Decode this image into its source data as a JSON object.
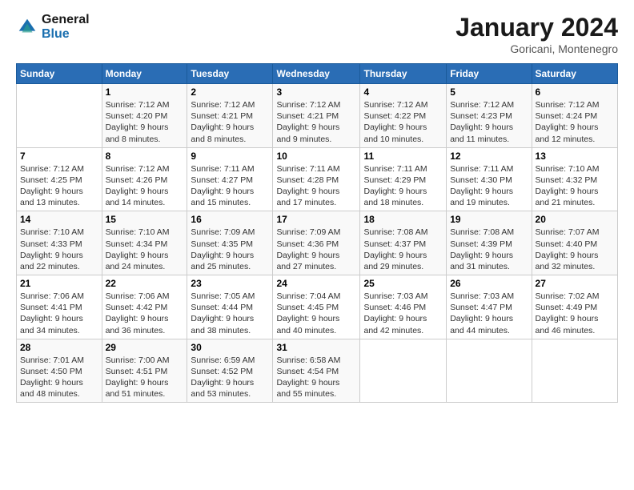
{
  "header": {
    "logo_general": "General",
    "logo_blue": "Blue",
    "main_title": "January 2024",
    "subtitle": "Goricani, Montenegro"
  },
  "calendar": {
    "days_of_week": [
      "Sunday",
      "Monday",
      "Tuesday",
      "Wednesday",
      "Thursday",
      "Friday",
      "Saturday"
    ],
    "weeks": [
      [
        {
          "day": "",
          "info": ""
        },
        {
          "day": "1",
          "info": "Sunrise: 7:12 AM\nSunset: 4:20 PM\nDaylight: 9 hours\nand 8 minutes."
        },
        {
          "day": "2",
          "info": "Sunrise: 7:12 AM\nSunset: 4:21 PM\nDaylight: 9 hours\nand 8 minutes."
        },
        {
          "day": "3",
          "info": "Sunrise: 7:12 AM\nSunset: 4:21 PM\nDaylight: 9 hours\nand 9 minutes."
        },
        {
          "day": "4",
          "info": "Sunrise: 7:12 AM\nSunset: 4:22 PM\nDaylight: 9 hours\nand 10 minutes."
        },
        {
          "day": "5",
          "info": "Sunrise: 7:12 AM\nSunset: 4:23 PM\nDaylight: 9 hours\nand 11 minutes."
        },
        {
          "day": "6",
          "info": "Sunrise: 7:12 AM\nSunset: 4:24 PM\nDaylight: 9 hours\nand 12 minutes."
        }
      ],
      [
        {
          "day": "7",
          "info": ""
        },
        {
          "day": "8",
          "info": "Sunrise: 7:12 AM\nSunset: 4:26 PM\nDaylight: 9 hours\nand 14 minutes."
        },
        {
          "day": "9",
          "info": "Sunrise: 7:11 AM\nSunset: 4:27 PM\nDaylight: 9 hours\nand 15 minutes."
        },
        {
          "day": "10",
          "info": "Sunrise: 7:11 AM\nSunset: 4:28 PM\nDaylight: 9 hours\nand 17 minutes."
        },
        {
          "day": "11",
          "info": "Sunrise: 7:11 AM\nSunset: 4:29 PM\nDaylight: 9 hours\nand 18 minutes."
        },
        {
          "day": "12",
          "info": "Sunrise: 7:11 AM\nSunset: 4:30 PM\nDaylight: 9 hours\nand 19 minutes."
        },
        {
          "day": "13",
          "info": "Sunrise: 7:10 AM\nSunset: 4:32 PM\nDaylight: 9 hours\nand 21 minutes."
        }
      ],
      [
        {
          "day": "14",
          "info": ""
        },
        {
          "day": "15",
          "info": "Sunrise: 7:10 AM\nSunset: 4:34 PM\nDaylight: 9 hours\nand 24 minutes."
        },
        {
          "day": "16",
          "info": "Sunrise: 7:09 AM\nSunset: 4:35 PM\nDaylight: 9 hours\nand 25 minutes."
        },
        {
          "day": "17",
          "info": "Sunrise: 7:09 AM\nSunset: 4:36 PM\nDaylight: 9 hours\nand 27 minutes."
        },
        {
          "day": "18",
          "info": "Sunrise: 7:08 AM\nSunset: 4:37 PM\nDaylight: 9 hours\nand 29 minutes."
        },
        {
          "day": "19",
          "info": "Sunrise: 7:08 AM\nSunset: 4:39 PM\nDaylight: 9 hours\nand 31 minutes."
        },
        {
          "day": "20",
          "info": "Sunrise: 7:07 AM\nSunset: 4:40 PM\nDaylight: 9 hours\nand 32 minutes."
        }
      ],
      [
        {
          "day": "21",
          "info": ""
        },
        {
          "day": "22",
          "info": "Sunrise: 7:06 AM\nSunset: 4:42 PM\nDaylight: 9 hours\nand 36 minutes."
        },
        {
          "day": "23",
          "info": "Sunrise: 7:05 AM\nSunset: 4:44 PM\nDaylight: 9 hours\nand 38 minutes."
        },
        {
          "day": "24",
          "info": "Sunrise: 7:04 AM\nSunset: 4:45 PM\nDaylight: 9 hours\nand 40 minutes."
        },
        {
          "day": "25",
          "info": "Sunrise: 7:03 AM\nSunset: 4:46 PM\nDaylight: 9 hours\nand 42 minutes."
        },
        {
          "day": "26",
          "info": "Sunrise: 7:03 AM\nSunset: 4:47 PM\nDaylight: 9 hours\nand 44 minutes."
        },
        {
          "day": "27",
          "info": "Sunrise: 7:02 AM\nSunset: 4:49 PM\nDaylight: 9 hours\nand 46 minutes."
        }
      ],
      [
        {
          "day": "28",
          "info": "Sunrise: 7:01 AM\nSunset: 4:50 PM\nDaylight: 9 hours\nand 48 minutes."
        },
        {
          "day": "29",
          "info": "Sunrise: 7:00 AM\nSunset: 4:51 PM\nDaylight: 9 hours\nand 51 minutes."
        },
        {
          "day": "30",
          "info": "Sunrise: 6:59 AM\nSunset: 4:52 PM\nDaylight: 9 hours\nand 53 minutes."
        },
        {
          "day": "31",
          "info": "Sunrise: 6:58 AM\nSunset: 4:54 PM\nDaylight: 9 hours\nand 55 minutes."
        },
        {
          "day": "",
          "info": ""
        },
        {
          "day": "",
          "info": ""
        },
        {
          "day": "",
          "info": ""
        }
      ]
    ],
    "week0_sunday_info": "Sunrise: 7:12 AM\nSunset: 4:25 PM\nDaylight: 9 hours\nand 13 minutes.",
    "week1_sunday_day": "7",
    "week2_sunday_day": "14",
    "week2_sunday_info": "Sunrise: 7:10 AM\nSunset: 4:33 PM\nDaylight: 9 hours\nand 22 minutes.",
    "week3_sunday_day": "21",
    "week3_sunday_info": "Sunrise: 7:06 AM\nSunset: 4:41 PM\nDaylight: 9 hours\nand 34 minutes.",
    "week1_sunday_info": "Sunrise: 7:12 AM\nSunset: 4:25 PM\nDaylight: 9 hours\nand 13 minutes."
  }
}
